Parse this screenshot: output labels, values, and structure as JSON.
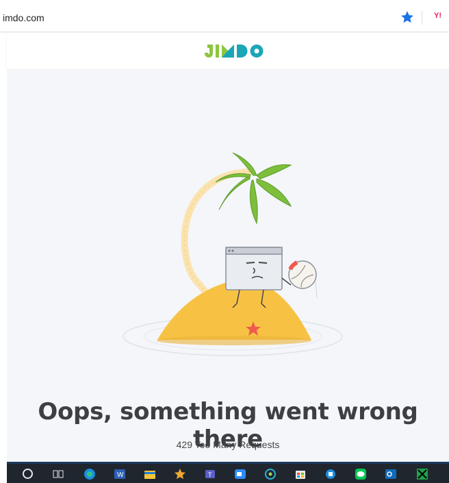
{
  "browser": {
    "url": "imdo.com",
    "bookmark_icon": "star-icon",
    "extension_icon": "extension-icon",
    "extension_label": "Y!"
  },
  "site": {
    "logo_text": "JIMDO",
    "illustration": "island-browser-illustration"
  },
  "error": {
    "headline": "Oops, something went wrong there",
    "message": "429 Too Many Requests"
  },
  "taskbar": {
    "items": [
      "search-icon",
      "task-view-icon",
      "edge-icon",
      "word-icon",
      "file-explorer-icon",
      "star-app-icon",
      "teams-icon",
      "zoom-icon",
      "network-app-icon",
      "store-icon",
      "app-icon",
      "line-icon",
      "outlook-icon",
      "other-app-icon"
    ]
  },
  "colors": {
    "jimdo_green": "#8cc63f",
    "jimdo_teal": "#1aa6b7",
    "sand": "#f7c244",
    "leaf": "#7dbf3a",
    "taskbar": "#20262e"
  }
}
